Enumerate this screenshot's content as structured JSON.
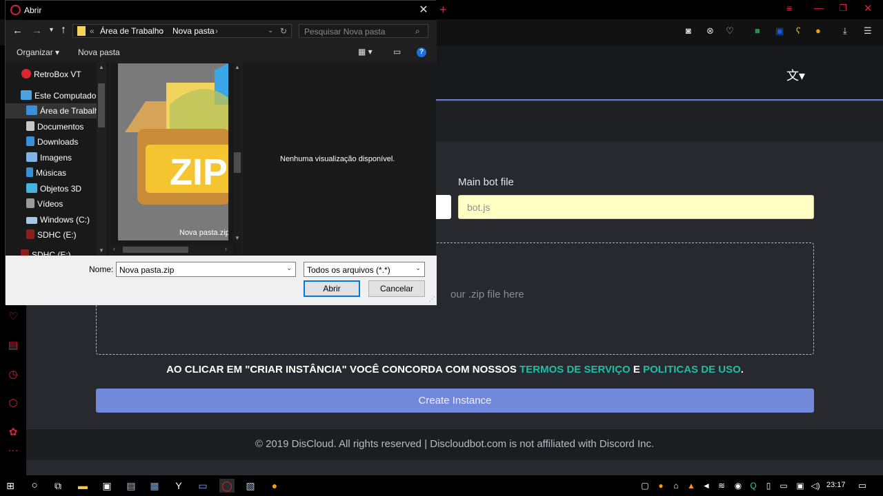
{
  "browser": {
    "toolbar_icons": [
      "camera-icon",
      "shield-x-icon",
      "heart-icon",
      "cube-icon",
      "bitwarden-icon",
      "key-icon",
      "extension-icon",
      "download-icon",
      "easy-setup-icon"
    ],
    "sidebar_icons": [
      "heart-icon",
      "news-icon",
      "history-icon",
      "cube-icon",
      "settings-icon",
      "more-icon"
    ]
  },
  "page": {
    "main_bot_label": "Main bot file",
    "main_bot_value": "bot.js",
    "dropzone_text": "our .zip file here",
    "terms_prefix": "AO CLICAR EM \"CRIAR INSTÂNCIA\" VOCÊ CONCORDA COM NOSSOS",
    "terms_link1": "TERMOS DE SERVIÇO",
    "terms_and": "E",
    "terms_link2": "POLITICAS DE USO",
    "terms_period": ".",
    "create_button": "Create Instance",
    "footer": "© 2019 DisCloud. All rights reserved | Discloudbot.com is not affiliated with Discord Inc.",
    "translate_icon": "translate-icon"
  },
  "dialog": {
    "title": "Abrir",
    "breadcrumb": [
      "«",
      "Área de Trabalho",
      "Nova pasta"
    ],
    "search_placeholder": "Pesquisar Nova pasta",
    "organize": "Organizar",
    "new_folder": "Nova pasta",
    "nav_items": [
      {
        "label": "RetroBox VT",
        "icon": "mega-icon",
        "color": "#d9272e"
      },
      {
        "label": "Este Computador",
        "icon": "computer-icon",
        "color": "#4aa3df"
      },
      {
        "label": "Área de Trabalho",
        "icon": "desktop-icon",
        "color": "#3b8fd6"
      },
      {
        "label": "Documentos",
        "icon": "documents-icon",
        "color": "#c8c8c8"
      },
      {
        "label": "Downloads",
        "icon": "downloads-icon",
        "color": "#3b8fd6"
      },
      {
        "label": "Imagens",
        "icon": "pictures-icon",
        "color": "#7fb2e6"
      },
      {
        "label": "Músicas",
        "icon": "music-icon",
        "color": "#3b8fd6"
      },
      {
        "label": "Objetos 3D",
        "icon": "3d-objects-icon",
        "color": "#45b5e0"
      },
      {
        "label": "Vídeos",
        "icon": "videos-icon",
        "color": "#9a9a9a"
      },
      {
        "label": "Windows (C:)",
        "icon": "drive-c-icon",
        "color": "#a9c6e0"
      },
      {
        "label": "SDHC (E:)",
        "icon": "sd-card-icon",
        "color": "#8b1f1f"
      },
      {
        "label": "SDHC (E:)",
        "icon": "sd-card-icon",
        "color": "#8b1f1f"
      }
    ],
    "file_name": "Nova pasta.zip",
    "preview_text": "Nenhuma visualização disponível.",
    "name_label": "Nome:",
    "name_value": "Nova pasta.zip",
    "filter_value": "Todos os arquivos (*.*)",
    "open_button": "Abrir",
    "cancel_button": "Cancelar"
  },
  "taskbar": {
    "time": "23:17"
  }
}
